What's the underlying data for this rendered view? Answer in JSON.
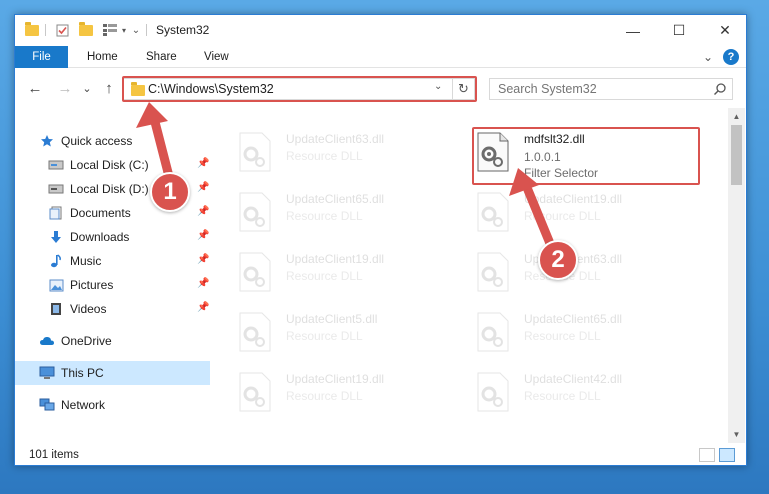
{
  "window": {
    "title": "System32",
    "controls": {
      "minimize": "—",
      "maximize": "☐",
      "close": "✕"
    }
  },
  "ribbon": {
    "tabs": [
      "File",
      "Home",
      "Share",
      "View"
    ],
    "collapse_glyph": "⌄",
    "help_glyph": "?"
  },
  "navigation": {
    "back": "←",
    "forward": "→",
    "recent": "⌄",
    "up": "↑"
  },
  "address": {
    "path": "C:\\Windows\\System32",
    "dropdown": "⌄",
    "refresh": "↻"
  },
  "search": {
    "placeholder": "Search System32"
  },
  "sidebar": {
    "items": [
      {
        "label": "Quick access",
        "icon": "star-icon",
        "pinned": false
      },
      {
        "label": "Local Disk (C:)",
        "icon": "drive-icon",
        "pinned": true
      },
      {
        "label": "Local Disk (D:)",
        "icon": "drive-icon",
        "pinned": true
      },
      {
        "label": "Documents",
        "icon": "documents-icon",
        "pinned": true
      },
      {
        "label": "Downloads",
        "icon": "download-icon",
        "pinned": true
      },
      {
        "label": "Music",
        "icon": "music-icon",
        "pinned": true
      },
      {
        "label": "Pictures",
        "icon": "pictures-icon",
        "pinned": true
      },
      {
        "label": "Videos",
        "icon": "video-icon",
        "pinned": true
      },
      {
        "label": "OneDrive",
        "icon": "cloud-icon",
        "pinned": false
      },
      {
        "label": "This PC",
        "icon": "monitor-icon",
        "pinned": false,
        "selected": true
      },
      {
        "label": "Network",
        "icon": "network-icon",
        "pinned": false
      }
    ],
    "pin_glyph": "📌"
  },
  "files": {
    "left_column": [
      {
        "name": "UpdateClient63.dll",
        "type": "Resource DLL"
      },
      {
        "name": "UpdateClient65.dll",
        "type": "Resource DLL"
      },
      {
        "name": "UpdateClient19.dll",
        "type": "Resource DLL"
      },
      {
        "name": "UpdateClient5.dll",
        "type": "Resource DLL"
      },
      {
        "name": "UpdateClient19.dll",
        "type": "Resource DLL"
      }
    ],
    "right_column": [
      {
        "name": "UpdateClient19.dll",
        "type": "Resource DLL"
      },
      {
        "name": "UpdateClient63.dll",
        "type": "Resource DLL"
      },
      {
        "name": "UpdateClient65.dll",
        "type": "Resource DLL"
      },
      {
        "name": "UpdateClient42.dll",
        "type": "Resource DLL"
      }
    ],
    "highlighted": {
      "name": "mdfslt32.dll",
      "version": "1.0.0.1",
      "type": "Filter Selector"
    }
  },
  "status": {
    "item_count": "101 items"
  },
  "callouts": [
    "1",
    "2"
  ],
  "colors": {
    "accent": "#1979ca",
    "highlight": "#d9534f",
    "selected": "#cce8ff"
  }
}
